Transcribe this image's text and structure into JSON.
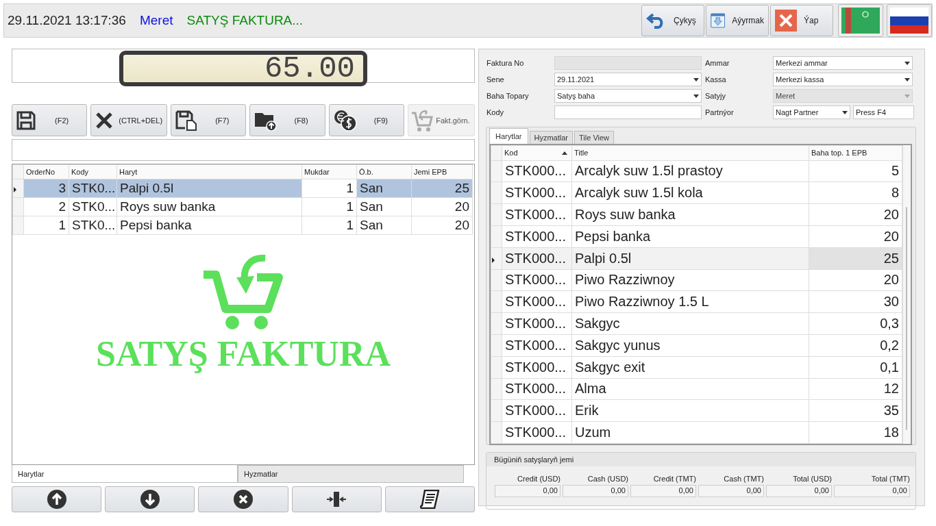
{
  "header": {
    "datetime": "29.11.2021 13:17:36",
    "user": "Meret",
    "title": "SATYŞ FAKTURA..."
  },
  "header_buttons": [
    {
      "label": "Çykyş",
      "kind": "back"
    },
    {
      "label": "Aýyrmak",
      "kind": "download"
    },
    {
      "label": "Ýap",
      "kind": "close"
    }
  ],
  "flags": [
    {
      "kind": "tm"
    },
    {
      "kind": "ru"
    }
  ],
  "display": {
    "value": "65.00"
  },
  "actions": [
    {
      "label": "(F2)",
      "kind": "save",
      "disabled": false
    },
    {
      "label": "(CTRL+DEL)",
      "kind": "delete",
      "disabled": false
    },
    {
      "label": "(F7)",
      "kind": "saveas",
      "disabled": false
    },
    {
      "label": "(F8)",
      "kind": "folder",
      "disabled": false
    },
    {
      "label": "(F9)",
      "kind": "coins",
      "disabled": false
    },
    {
      "label": "Fakt.görn.",
      "kind": "cart",
      "disabled": true
    }
  ],
  "order_grid": {
    "columns": [
      "OrderNo",
      "Kody",
      "Haryt",
      "Mukdar",
      "Ö.b.",
      "Jemi EPB"
    ],
    "rows": [
      {
        "cells": [
          "3",
          "STK0...",
          "Palpi 0.5l",
          "1",
          "San",
          "25"
        ],
        "selected": true
      },
      {
        "cells": [
          "2",
          "STK0...",
          "Roys suw banka",
          "1",
          "San",
          "20"
        ],
        "selected": false
      },
      {
        "cells": [
          "1",
          "STK0...",
          "Pepsi banka",
          "1",
          "San",
          "20"
        ],
        "selected": false
      }
    ],
    "logo_text": "SATYŞ FAKTURA"
  },
  "bottom_tabs": [
    {
      "label": "Harytlar",
      "selected": true
    },
    {
      "label": "Hyzmatlar",
      "selected": false
    }
  ],
  "nav_buttons": [
    {
      "kind": "up"
    },
    {
      "kind": "down"
    },
    {
      "kind": "remove"
    },
    {
      "kind": "merge"
    },
    {
      "kind": "receipt"
    }
  ],
  "form": [
    {
      "label": "Faktura No",
      "kind": "text",
      "disabled": true
    },
    {
      "label": "Ammar",
      "value": "Merkezi ammar",
      "kind": "dropdown",
      "disabled": false
    },
    {
      "label": "Sene",
      "value": "29.11.2021",
      "kind": "dropdown",
      "disabled": false
    },
    {
      "label": "Kassa",
      "value": "Merkezi kassa",
      "kind": "dropdown",
      "disabled": false
    },
    {
      "label": "Baha Topary",
      "value": "Satyş baha",
      "kind": "dropdown",
      "disabled": false
    },
    {
      "label": "Satyjy",
      "value": "Meret",
      "kind": "dropdown",
      "disabled": true
    },
    {
      "label": "Kody",
      "kind": "text",
      "disabled": false
    },
    {
      "label": "Partnýor",
      "value": "Nagt Partner",
      "kind": "partner",
      "extra": "Press F4",
      "disabled": false
    }
  ],
  "product_tabs": [
    {
      "label": "Harytlar",
      "selected": true
    },
    {
      "label": "Hyzmatlar",
      "selected": false
    },
    {
      "label": "Tile View",
      "selected": false
    }
  ],
  "product_grid": {
    "columns": [
      "Kod",
      "Title",
      "Baha top. 1 EPB"
    ],
    "rows": [
      {
        "cells": [
          "STK000...",
          "Arcalyk suw 1.5l prastoy",
          "5"
        ],
        "selected": false
      },
      {
        "cells": [
          "STK000...",
          "Arcalyk suw 1.5l kola",
          "8"
        ],
        "selected": false
      },
      {
        "cells": [
          "STK000...",
          "Roys suw banka",
          "20"
        ],
        "selected": false
      },
      {
        "cells": [
          "STK000...",
          "Pepsi banka",
          "20"
        ],
        "selected": false
      },
      {
        "cells": [
          "STK000...",
          "Palpi 0.5l",
          "25"
        ],
        "selected": true
      },
      {
        "cells": [
          "STK000...",
          "Piwo Razziwnoy",
          "20"
        ],
        "selected": false
      },
      {
        "cells": [
          "STK000...",
          "Piwo Razziwnoy 1.5 L",
          "30"
        ],
        "selected": false
      },
      {
        "cells": [
          "STK000...",
          "Sakgyc",
          "0,3"
        ],
        "selected": false
      },
      {
        "cells": [
          "STK000...",
          "Sakgyc yunus",
          "0,2"
        ],
        "selected": false
      },
      {
        "cells": [
          "STK000...",
          "Sakgyc exit",
          "0,1"
        ],
        "selected": false
      },
      {
        "cells": [
          "STK000...",
          "Alma",
          "12"
        ],
        "selected": false
      },
      {
        "cells": [
          "STK000...",
          "Erik",
          "35"
        ],
        "selected": false
      },
      {
        "cells": [
          "STK000...",
          "Uzum",
          "18"
        ],
        "selected": false
      }
    ]
  },
  "summary": {
    "title": "Bügüniň satyşlaryň jemi",
    "items": [
      {
        "label": "Credit (USD)",
        "value": "0,00"
      },
      {
        "label": "Cash (USD)",
        "value": "0,00"
      },
      {
        "label": "Credit (TMT)",
        "value": "0,00"
      },
      {
        "label": "Cash (TMT)",
        "value": "0,00"
      },
      {
        "label": "Total (USD)",
        "value": "0,00"
      },
      {
        "label": "Total (TMT)",
        "value": "0,00"
      }
    ]
  }
}
